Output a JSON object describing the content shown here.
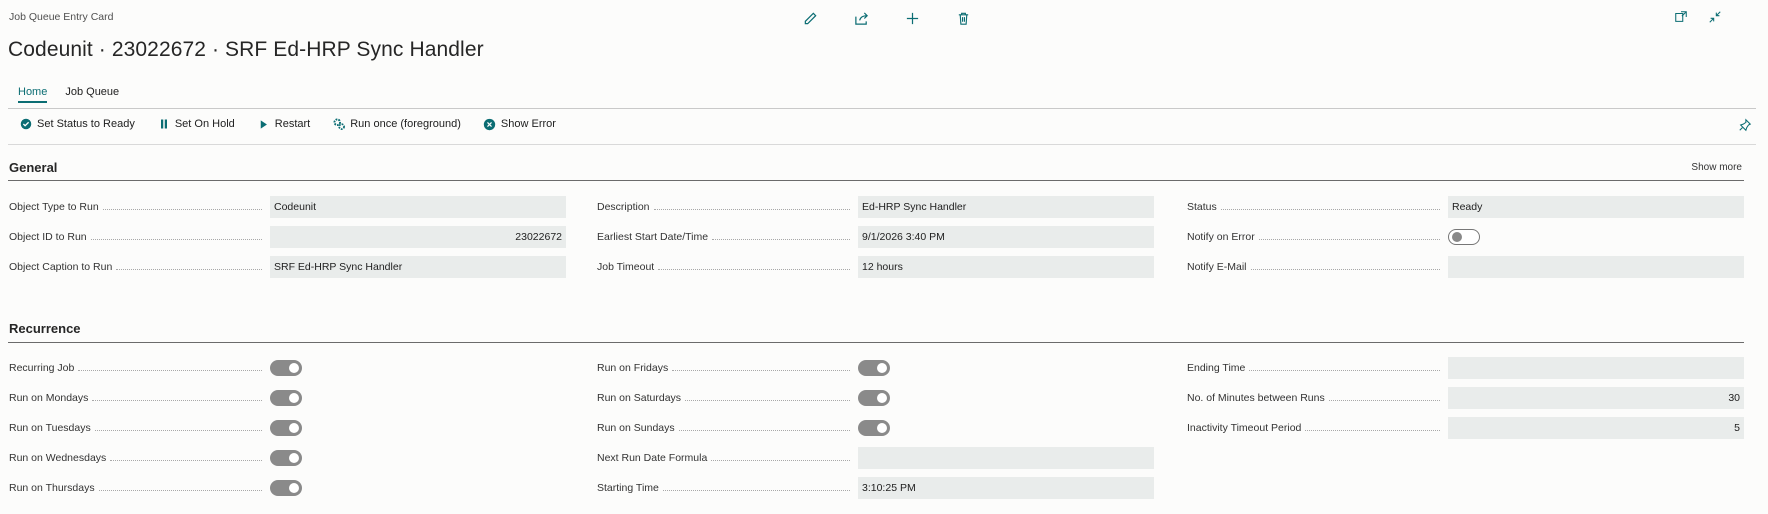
{
  "breadcrumb": "Job Queue Entry Card",
  "title": "Codeunit · 23022672 · SRF Ed-HRP Sync Handler",
  "tabs": [
    {
      "label": "Home",
      "active": true
    },
    {
      "label": "Job Queue",
      "active": false
    }
  ],
  "actions": {
    "set_ready": "Set Status to Ready",
    "set_hold": "Set On Hold",
    "restart": "Restart",
    "run_once": "Run once (foreground)",
    "show_error": "Show Error"
  },
  "accent_color": "#0b6d73",
  "general": {
    "title": "General",
    "show_more": "Show more",
    "object_type_label": "Object Type to Run",
    "object_type_value": "Codeunit",
    "object_id_label": "Object ID to Run",
    "object_id_value": "23022672",
    "object_caption_label": "Object Caption to Run",
    "object_caption_value": "SRF Ed-HRP Sync Handler",
    "description_label": "Description",
    "description_value": "Ed-HRP Sync Handler",
    "earliest_start_label": "Earliest Start Date/Time",
    "earliest_start_value": "9/1/2026 3:40 PM",
    "job_timeout_label": "Job Timeout",
    "job_timeout_value": "12 hours",
    "status_label": "Status",
    "status_value": "Ready",
    "notify_error_label": "Notify on Error",
    "notify_error_value": false,
    "notify_email_label": "Notify E-Mail",
    "notify_email_value": ""
  },
  "recurrence": {
    "title": "Recurrence",
    "recurring_label": "Recurring Job",
    "recurring_value": true,
    "mon_label": "Run on Mondays",
    "mon_value": true,
    "tue_label": "Run on Tuesdays",
    "tue_value": true,
    "wed_label": "Run on Wednesdays",
    "wed_value": true,
    "thu_label": "Run on Thursdays",
    "thu_value": true,
    "fri_label": "Run on Fridays",
    "fri_value": true,
    "sat_label": "Run on Saturdays",
    "sat_value": true,
    "sun_label": "Run on Sundays",
    "sun_value": true,
    "next_formula_label": "Next Run Date Formula",
    "next_formula_value": "",
    "starting_time_label": "Starting Time",
    "starting_time_value": "3:10:25 PM",
    "ending_time_label": "Ending Time",
    "ending_time_value": "",
    "minutes_between_label": "No. of Minutes between Runs",
    "minutes_between_value": "30",
    "inactivity_label": "Inactivity Timeout Period",
    "inactivity_value": "5"
  }
}
